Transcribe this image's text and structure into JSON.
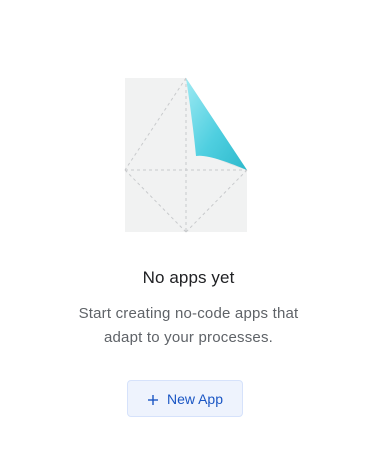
{
  "empty_state": {
    "title": "No apps yet",
    "subtitle": "Start creating no-code apps that adapt to your processes.",
    "illustration_icon": "folded-paper-icon"
  },
  "actions": {
    "new_app_label": "New App",
    "new_app_icon": "plus-icon"
  },
  "colors": {
    "accent": "#1a56c4",
    "button_bg": "#eef3fd",
    "fold_cyan": "#4ccfe0"
  }
}
